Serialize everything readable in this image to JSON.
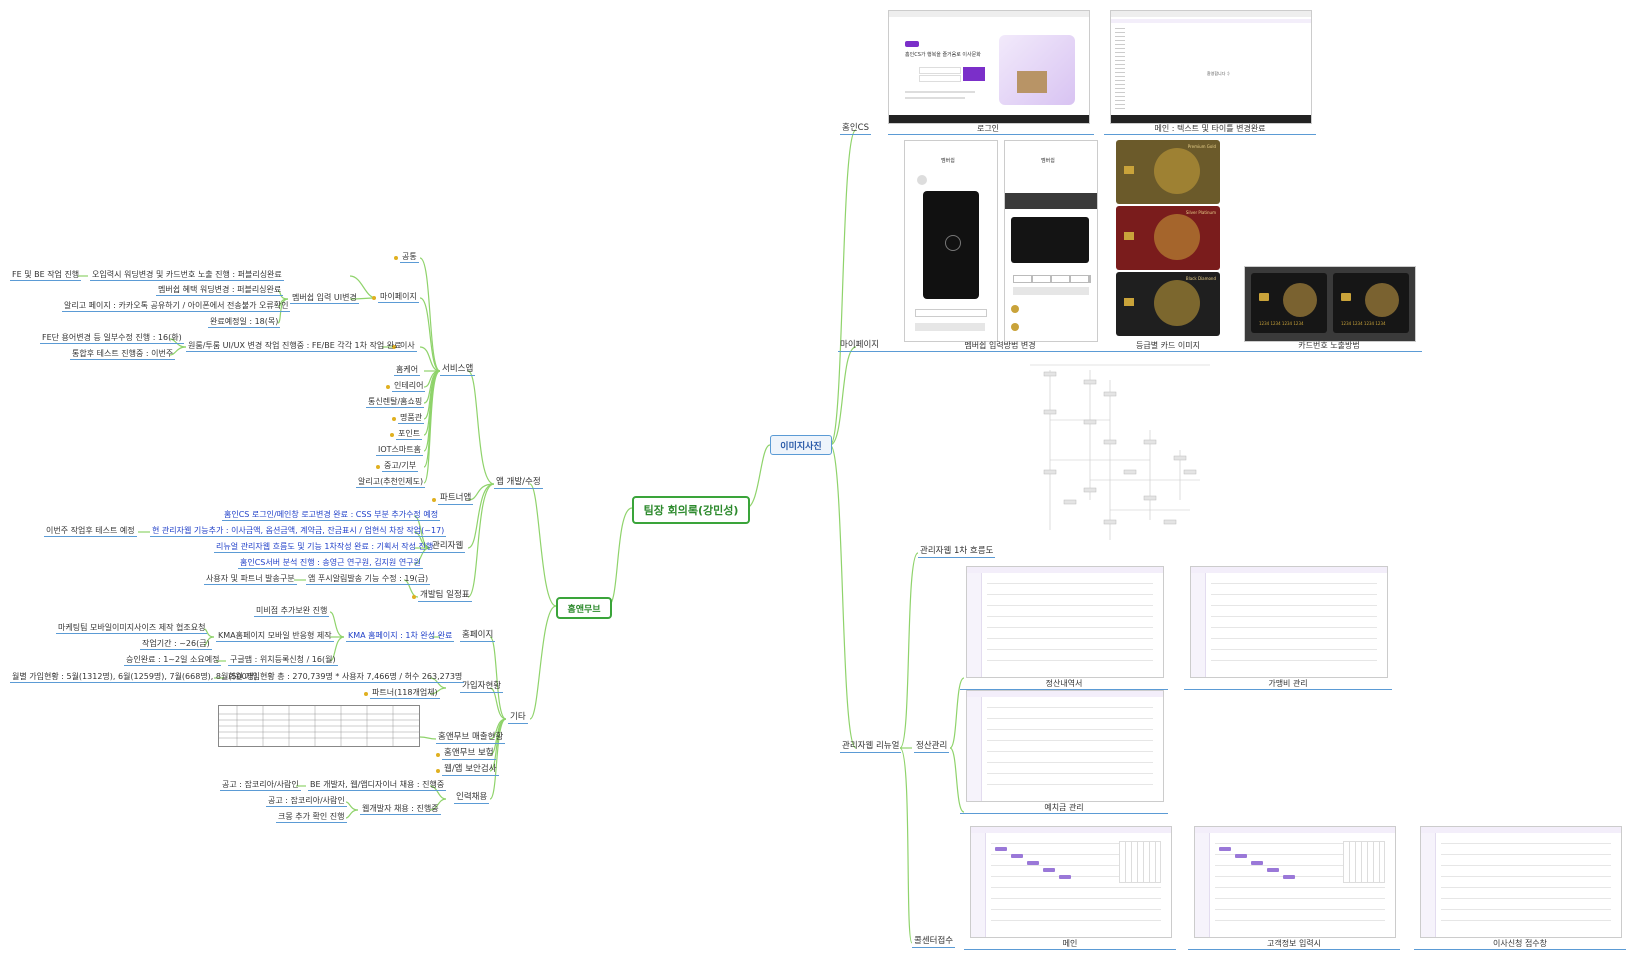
{
  "root": "팀장 회의록(강민성)",
  "left": {
    "branch": "홈앤무브",
    "app": {
      "label": "앱 개발/수정",
      "service": {
        "label": "서비스앱",
        "common": "공통",
        "mypage": "마이페이지",
        "mp_items": {
          "a": "오입력시 워딩변경 및 카드번호 노출 진행 : 퍼블리싱완료",
          "a_sub": "FE 및 BE 작업 진행",
          "b": "멤버쉽 입력 UI변경",
          "b1": "멤버쉽 혜택 워딩변경 : 퍼블리싱완료",
          "b2": "알리고 페이지 : 카카오톡 공유하기 / 아이폰에서 전송불가 오류확인",
          "b3": "완료예정일 : 18(목)"
        },
        "move": "이사",
        "move_items": {
          "a": "원룸/투룸 UI/UX 변경 작업 진행중 : FE/BE 각각 1차 작업 완료",
          "a1": "FE단 용어변경 등 일부수정 진행 : 16(화)",
          "a2": "통합후 테스트 진행중 : 이번주"
        },
        "others": [
          "홈케어",
          "인테리어",
          "통신렌탈/홈쇼핑",
          "명품관",
          "포인트",
          "IOT스마트홈",
          "중고/기부",
          "알리고(추천인제도)"
        ]
      },
      "partner": "파트너앱",
      "admin": {
        "label": "관리자웹",
        "a": "홈인CS 로그인/메인창 로고변경 완료 : CSS 부분 추가수정 예정",
        "b": "현 관리자웹 기능추가 : 이사금액, 옵션금액, 계약금, 잔금표시 / 업현식 차장 작업(~17)",
        "b_sub": "이번주 작업후 테스트 예정",
        "c": "리뉴얼 관리자웹 흐름도 및 기능 1차작성 완료 : 기획서 작성 진행",
        "d": "홈인CS서버 분석 진행 : 송영근 연구원, 김지원 연구원"
      },
      "schedule": {
        "label": "개발팀 일정표",
        "a": "앱 푸시알림발송 기능 수정 : 19(금)",
        "a_sub": "사용자 및 파트너 발송구분"
      }
    },
    "etc": {
      "label": "기타",
      "homepage": {
        "label": "홈페이지",
        "a": "KMA 홈페이지 : 1차 완성 완료",
        "a1": "미비점 추가보완 진행",
        "a2": "KMA홈페이지 모바일 반응형 제작",
        "a2_1": "마케팅팀 모바일이미지사이즈 제작 협조요청",
        "a2_2": "작업기간 : ~26(금)",
        "a3": "구글맵 : 위치등록신청 / 16(월)",
        "a3_1": "승인완료 : 1~2일 소요예정"
      },
      "signup": {
        "label": "가입자현황",
        "a": "회원 가입현황 총 : 270,739명  * 사용자 7,466명 / 허수 263,273명",
        "a_sub": "월별 가입현황 : 5월(1312명), 6월(1259명), 7월(668명), 8월(500명)",
        "b": "파트너(118개업체)"
      },
      "sales": "홈앤무브 매출현황",
      "insurance": "홈앤무브 보험",
      "security": "웹/앱 보안검사",
      "hiring": {
        "label": "인력채용",
        "a": "BE 개발자, 웹/앱디자이너 채용 : 진행중",
        "a_sub": "공고 : 잡코리아/사람인",
        "b": "웹개발자 채용 : 진행중",
        "b1": "공고 : 잡코리아/사람인",
        "b2": "크몽 추가 확인 진행"
      }
    }
  },
  "right": {
    "branch": "이미지사진",
    "homein_cs": {
      "label": "홈인CS",
      "caps": [
        "로그인",
        "메인 : 텍스트 및 타이틀 변경완료"
      ],
      "login_title": "홈인CS가 행복을 즐거움로 이사문화",
      "main_text": "환영합니다 :)"
    },
    "mypage": {
      "label": "마이페이지",
      "caps": [
        "멤버쉽 입력방법 변경",
        "등급별 카드 이미지",
        "카드번호 노출방법"
      ],
      "phone_title": "멤버쉽",
      "card_names": [
        "Premium Gold",
        "Silver Platinum",
        "Black Diamond"
      ],
      "card_number": "1234 1234 1234 1234"
    },
    "admin": {
      "label": "관리자웹 리뉴얼",
      "flow": "관리자웹 1차 흐름도",
      "settlement": "정산관리",
      "caps_settle": [
        "정산내역서",
        "가맹비 관리",
        "예치금 관리"
      ],
      "callcenter": "콜센터접수",
      "caps_call": [
        "메인",
        "고객정보 입력시",
        "이사신청 접수창"
      ]
    }
  },
  "colors": {
    "accent_green": "#3aa43a",
    "link_blue": "#5b9bd5",
    "text_blue": "#1f3fc8",
    "purple": "#7b2fc9"
  }
}
